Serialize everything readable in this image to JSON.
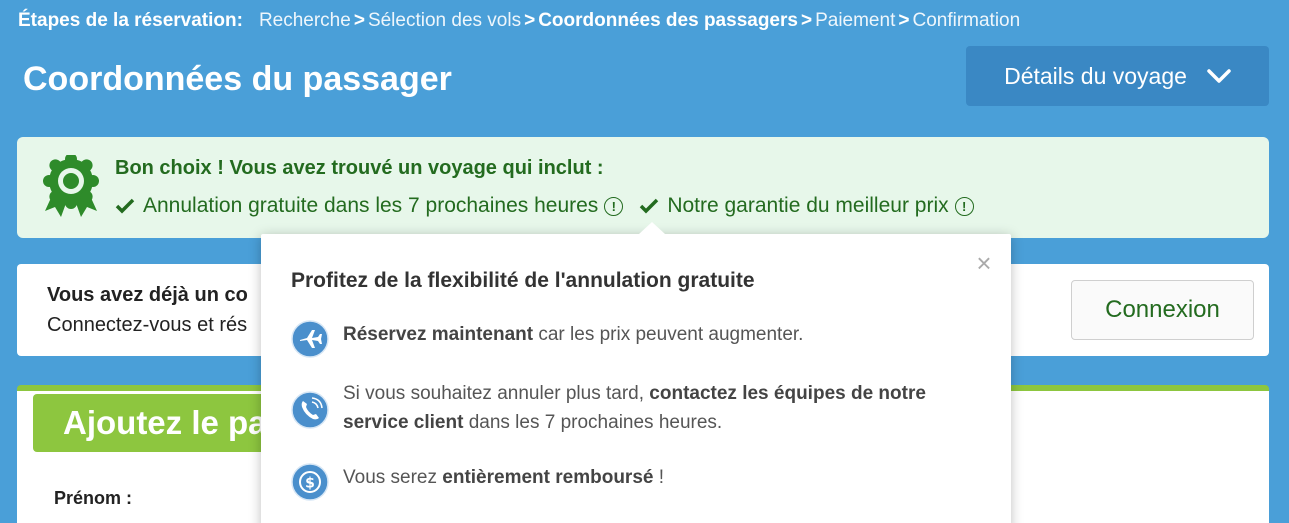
{
  "breadcrumb": {
    "label": "Étapes de la réservation:",
    "steps": [
      "Recherche",
      "Sélection des vols",
      "Coordonnées des passagers",
      "Paiement",
      "Confirmation"
    ],
    "separator": ">"
  },
  "header": {
    "title": "Coordonnées du passager",
    "details_button": "Détails du voyage"
  },
  "banner": {
    "title": "Bon choix ! Vous avez trouvé un voyage qui inclut :",
    "features": [
      "Annulation gratuite dans les 7 prochaines heures",
      "Notre garantie du meilleur prix"
    ],
    "info_glyph": "!"
  },
  "login": {
    "title": "Vous avez déjà un co",
    "subtitle": "Connectez-vous et rés",
    "button": "Connexion"
  },
  "passenger": {
    "title": "Ajoutez le pa",
    "first_name_label": "Prénom :"
  },
  "popup": {
    "title": "Profitez de la flexibilité de l'annulation gratuite",
    "close": "×",
    "row1": {
      "bold": "Réservez maintenant",
      "rest": " car les prix peuvent augmenter."
    },
    "row2": {
      "pre": "Si vous souhaitez annuler plus tard, ",
      "bold": "contactez les équipes de notre service client",
      "rest": " dans les 7 prochaines heures."
    },
    "row3": {
      "pre": "Vous serez ",
      "bold": "entièrement remboursé",
      "rest": " !"
    }
  },
  "colors": {
    "background": "#4a9fd8",
    "accent_green": "#8dc63f",
    "text_green": "#236b1f",
    "banner_bg": "#e7f7ea"
  },
  "icons": [
    "award-badge-icon",
    "check-icon",
    "info-icon",
    "close-icon",
    "plane-icon",
    "phone-icon",
    "dollar-coin-icon",
    "chevron-down-icon"
  ]
}
